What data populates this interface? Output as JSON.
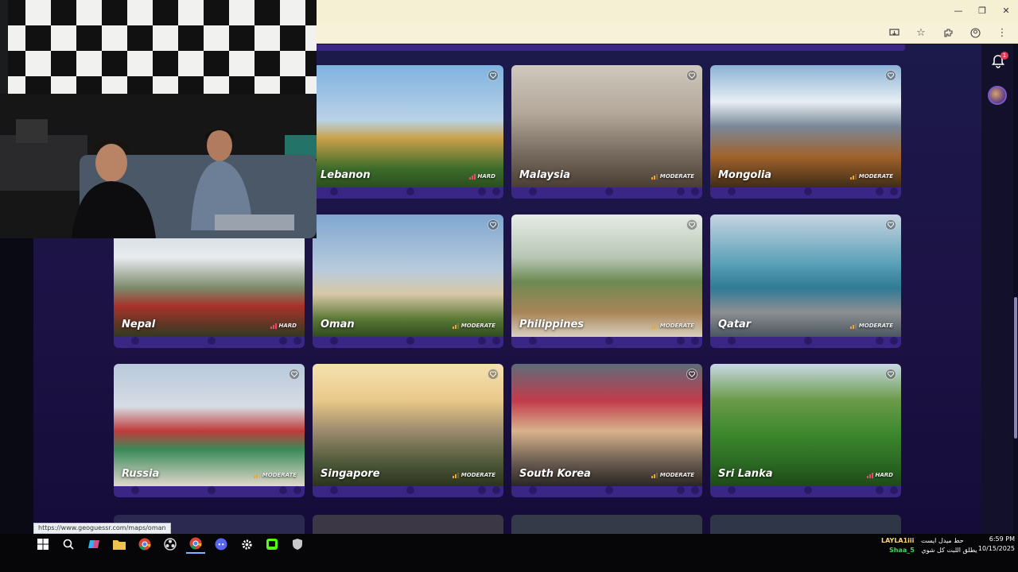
{
  "browser": {
    "window_controls": [
      "—",
      "❐",
      "✕"
    ]
  },
  "status_url": "https://www.geoguessr.com/maps/oman",
  "notifications": {
    "count": "1"
  },
  "cards": [
    {
      "name": "Lebanon",
      "difficulty": "HARD",
      "level": 3
    },
    {
      "name": "Malaysia",
      "difficulty": "MODERATE",
      "level": 2
    },
    {
      "name": "Mongolia",
      "difficulty": "MODERATE",
      "level": 2
    },
    {
      "name": "Nepal",
      "difficulty": "HARD",
      "level": 3
    },
    {
      "name": "Oman",
      "difficulty": "MODERATE",
      "level": 2
    },
    {
      "name": "Philippines",
      "difficulty": "MODERATE",
      "level": 2
    },
    {
      "name": "Qatar",
      "difficulty": "MODERATE",
      "level": 2
    },
    {
      "name": "Russia",
      "difficulty": "MODERATE",
      "level": 2
    },
    {
      "name": "Singapore",
      "difficulty": "MODERATE",
      "level": 2
    },
    {
      "name": "South Korea",
      "difficulty": "MODERATE",
      "level": 2
    },
    {
      "name": "Sri Lanka",
      "difficulty": "HARD",
      "level": 3
    }
  ],
  "taskbar": {
    "time": "6:59 PM",
    "date": "10/15/2025",
    "chat_user_1": "LAYLA1iii",
    "chat_msg_1": "حط ميدل ايست",
    "chat_user_2": "Shaa_5",
    "chat_msg_2": "يطلق اللبت كل شوي"
  },
  "colors": {
    "accent": "#3a2785",
    "page_bg": "#160c3a",
    "moderate": "#e8a63a",
    "hard": "#e74b6b"
  }
}
